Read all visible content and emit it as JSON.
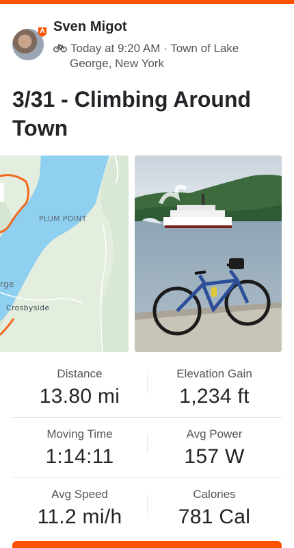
{
  "colors": {
    "accent": "#fc5200",
    "text": "#242428",
    "muted": "#545459"
  },
  "activity": {
    "athlete_name": "Sven Migot",
    "sport_icon": "bike-icon",
    "time": "Today at 9:20 AM",
    "separator": "·",
    "location_line1": "Town of Lake",
    "location_line2": "George, New York",
    "title": "3/31 - Climbing Around Town"
  },
  "map": {
    "labels": {
      "plum_point": "PLUM POINT",
      "george": "rge",
      "crosbyside": "Crosbyside"
    }
  },
  "stats": [
    {
      "label": "Distance",
      "value": "13.80 mi"
    },
    {
      "label": "Elevation Gain",
      "value": "1,234 ft"
    },
    {
      "label": "Moving Time",
      "value": "1:14:11"
    },
    {
      "label": "Avg Power",
      "value": "157 W"
    },
    {
      "label": "Avg Speed",
      "value": "11.2 mi/h"
    },
    {
      "label": "Calories",
      "value": "781 Cal"
    }
  ]
}
